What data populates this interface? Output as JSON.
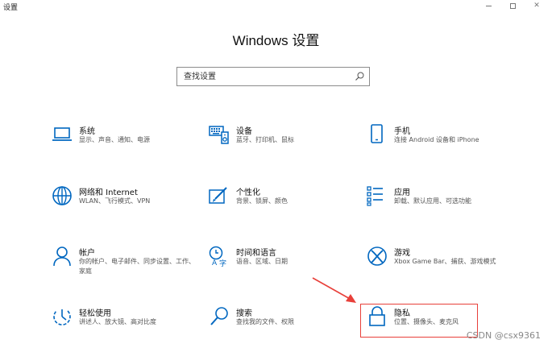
{
  "window": {
    "title": "设置"
  },
  "page": {
    "title": "Windows 设置"
  },
  "search": {
    "placeholder": "查找设置"
  },
  "accent_color": "#0067c0",
  "highlight_color": "#e8403a",
  "tiles": [
    {
      "id": "system",
      "icon": "laptop-icon",
      "title": "系统",
      "desc": "显示、声音、通知、电源"
    },
    {
      "id": "devices",
      "icon": "keyboard-speaker-icon",
      "title": "设备",
      "desc": "蓝牙、打印机、鼠标"
    },
    {
      "id": "phone",
      "icon": "phone-icon",
      "title": "手机",
      "desc": "连接 Android 设备和 iPhone"
    },
    {
      "id": "network",
      "icon": "globe-icon",
      "title": "网络和 Internet",
      "desc": "WLAN、飞行模式、VPN"
    },
    {
      "id": "personalization",
      "icon": "paint-icon",
      "title": "个性化",
      "desc": "背景、锁屏、颜色"
    },
    {
      "id": "apps",
      "icon": "apps-list-icon",
      "title": "应用",
      "desc": "卸载、默认应用、可选功能"
    },
    {
      "id": "accounts",
      "icon": "person-icon",
      "title": "帐户",
      "desc": "你的帐户、电子邮件、同步设置、工作、家庭"
    },
    {
      "id": "time",
      "icon": "time-language-icon",
      "title": "时间和语言",
      "desc": "语音、区域、日期"
    },
    {
      "id": "gaming",
      "icon": "xbox-icon",
      "title": "游戏",
      "desc": "Xbox Game Bar、捕获、游戏模式"
    },
    {
      "id": "ease",
      "icon": "ease-of-access-icon",
      "title": "轻松使用",
      "desc": "讲述人、放大镜、高对比度"
    },
    {
      "id": "search",
      "icon": "search-icon",
      "title": "搜索",
      "desc": "查找我的文件、权限"
    },
    {
      "id": "privacy",
      "icon": "lock-icon",
      "title": "隐私",
      "desc": "位置、摄像头、麦克风"
    }
  ],
  "watermark": "CSDN @csx9361"
}
